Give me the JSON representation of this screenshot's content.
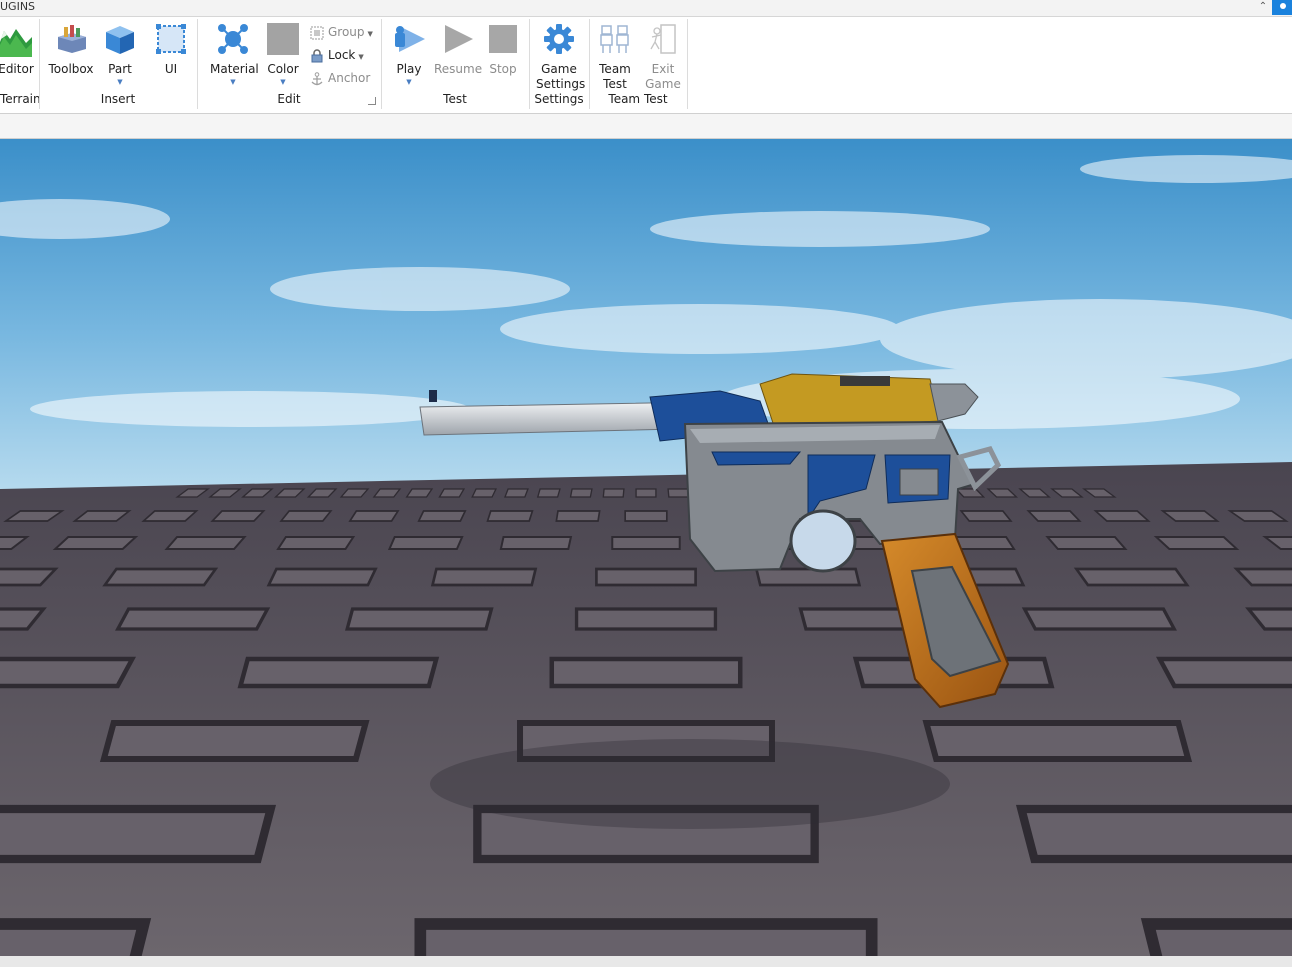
{
  "top_tab": {
    "label": "UGINS"
  },
  "ribbon": {
    "terrain": {
      "editor_label": "Editor",
      "group_label": "Terrain"
    },
    "insert": {
      "group_label": "Insert",
      "buttons": [
        {
          "label": "Toolbox",
          "icon": "toolbox-icon"
        },
        {
          "label": "Part",
          "icon": "part-cube-icon"
        },
        {
          "label": "UI",
          "icon": "ui-frame-icon"
        }
      ]
    },
    "edit": {
      "group_label": "Edit",
      "material_label": "Material",
      "color_label": "Color",
      "group_btn": "Group",
      "lock_btn": "Lock",
      "anchor_btn": "Anchor"
    },
    "test": {
      "group_label": "Test",
      "play_label": "Play",
      "resume_label": "Resume",
      "stop_label": "Stop"
    },
    "settings": {
      "group_label": "Settings",
      "game_settings_line1": "Game",
      "game_settings_line2": "Settings"
    },
    "team_test": {
      "group_label": "Team Test",
      "team_test_line1": "Team",
      "team_test_line2": "Test",
      "exit_game_line1": "Exit",
      "exit_game_line2": "Game"
    }
  },
  "colors": {
    "accent_blue": "#1a82dd",
    "color_swatch": "#a3a3a3",
    "sky_top": "#3b8fc9",
    "baseplate": "#5f5a60",
    "gun_blue": "#1d4f9a",
    "gun_gold": "#c49a22",
    "gun_wood": "#c0741e"
  }
}
